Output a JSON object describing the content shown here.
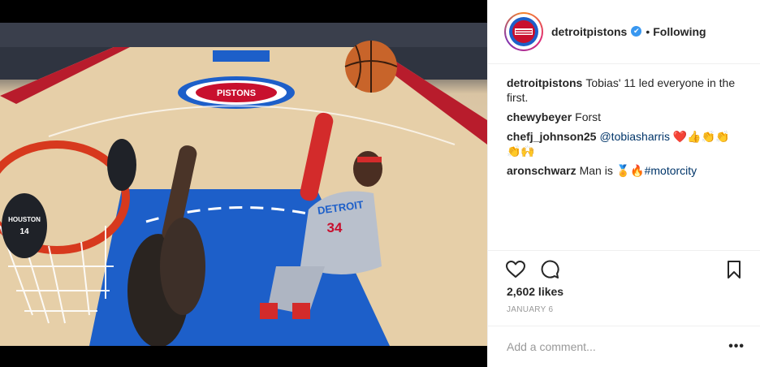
{
  "post": {
    "account": "detroitpistons",
    "follow_separator": "•",
    "follow_status": "Following",
    "verified_glyph": "✔",
    "avatar_text": "DETROIT\nPISTONS",
    "likes": "2,602 likes",
    "date": "JANUARY 6",
    "add_comment_placeholder": "Add a comment...",
    "more_glyph": "•••"
  },
  "comments": [
    {
      "user": "detroitpistons",
      "text": "Tobias' 11 led everyone in the first."
    },
    {
      "user": "chewybeyer",
      "text": "Forst"
    },
    {
      "user": "chefj_johnson25",
      "mention": "@tobiasharris",
      "text": " ❤️👍👏👏👏🙌"
    },
    {
      "user": "aronschwarz",
      "text": "Man is 🏅🔥",
      "mention": "#motorcity"
    }
  ],
  "image": {
    "court_logo": "PISTONS",
    "jersey_team": "DETROIT",
    "jersey_number": "34",
    "opponent_jersey": "HOUSTON",
    "opponent_number": "14"
  },
  "icons": {
    "heart": "heart-icon",
    "comment": "comment-icon",
    "bookmark": "bookmark-icon"
  },
  "colors": {
    "accent_link": "#003569",
    "verified": "#3897f0",
    "muted": "#999999",
    "court_blue": "#1d5fc9",
    "pistons_red": "#c8102e"
  }
}
